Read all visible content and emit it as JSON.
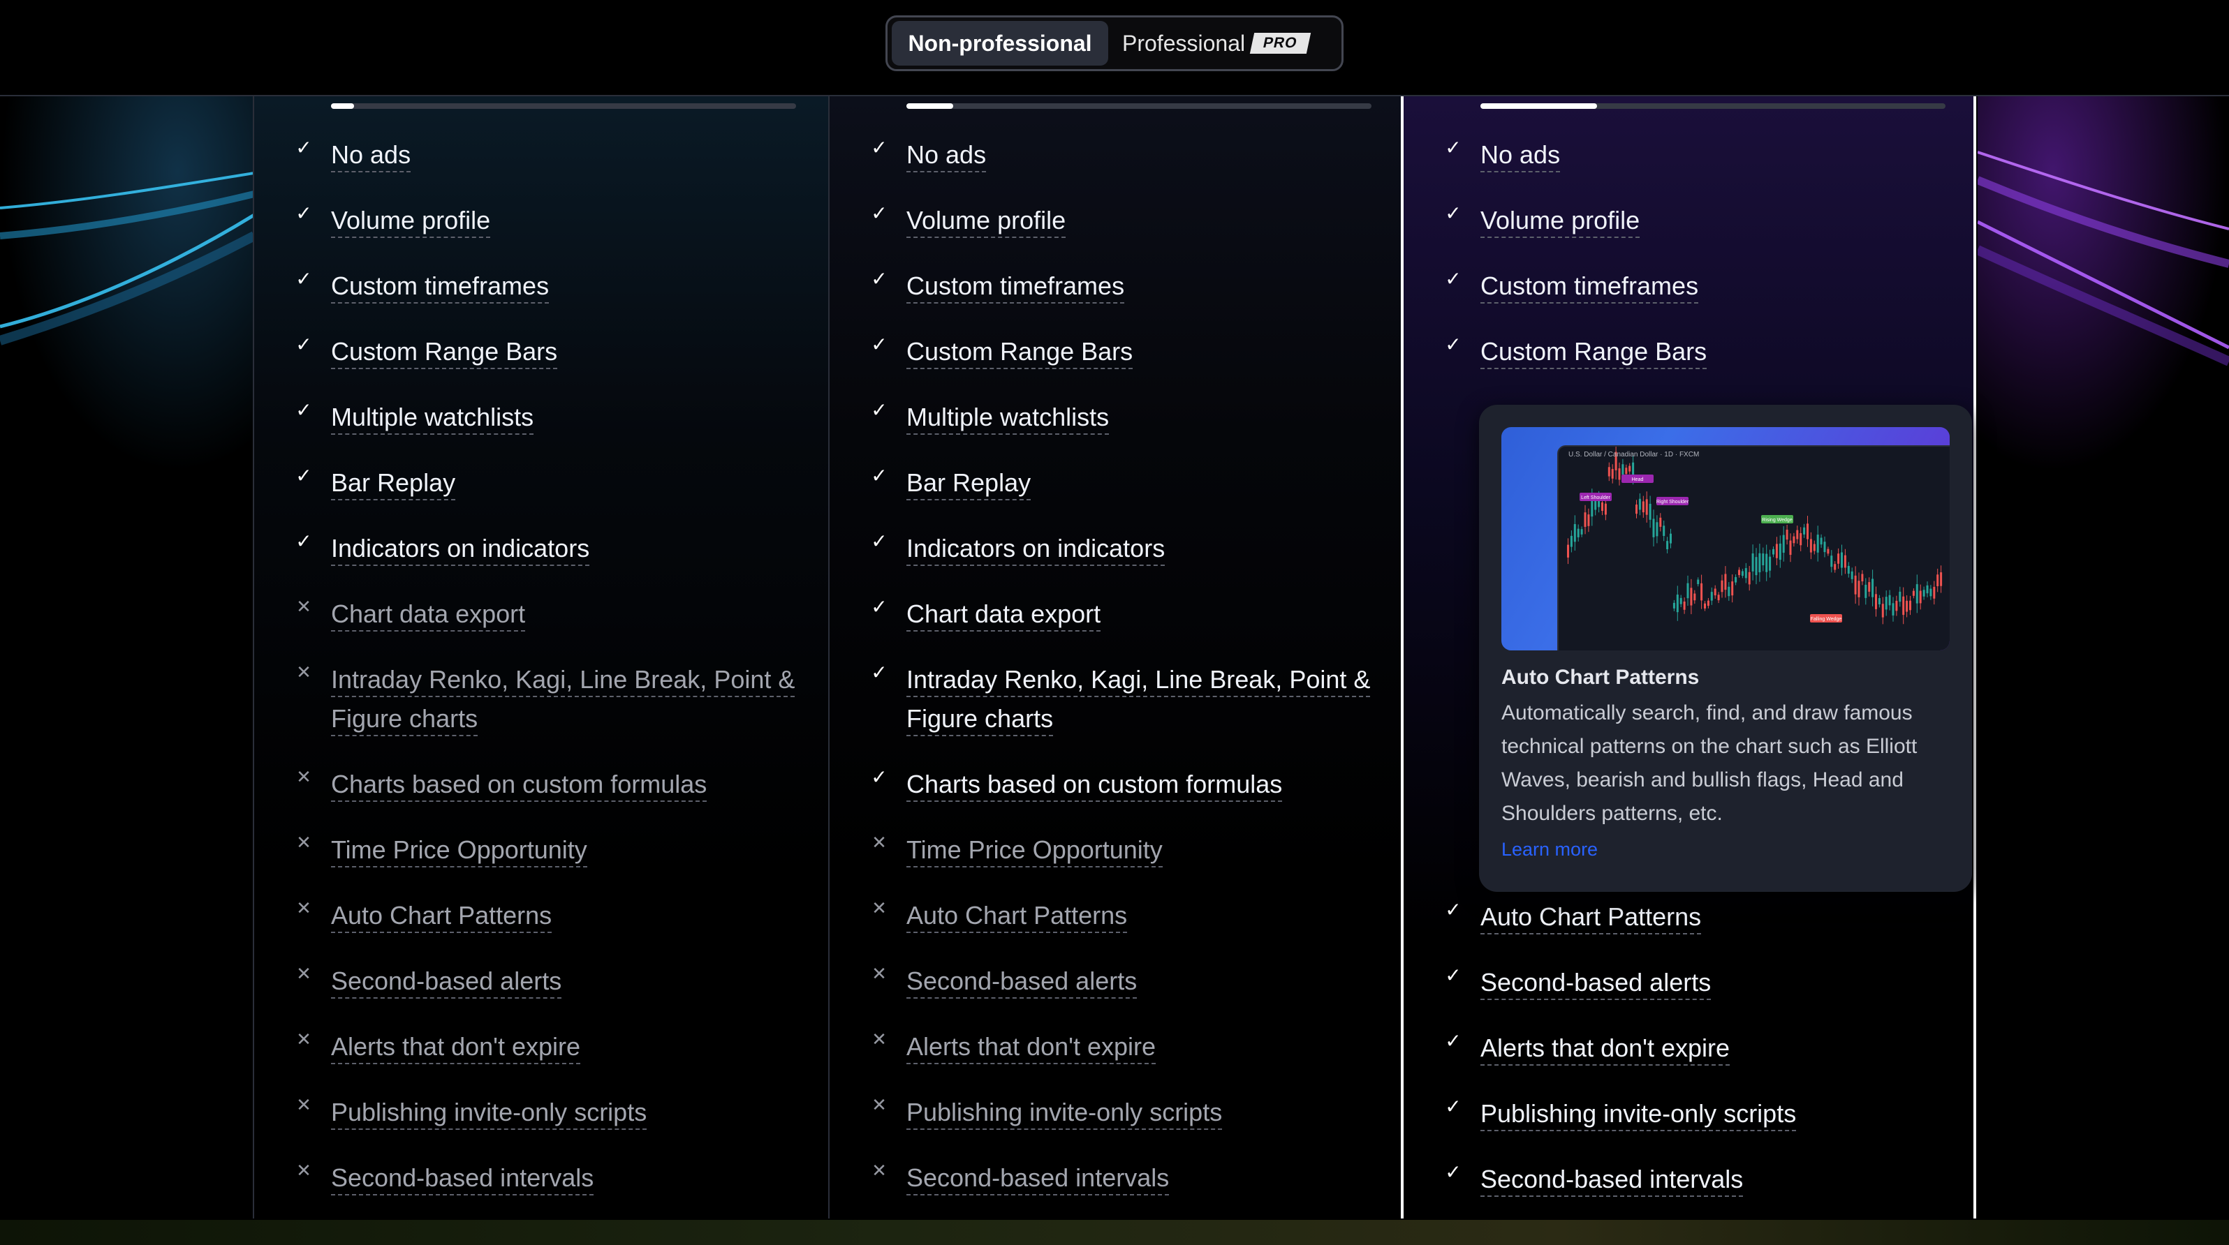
{
  "toggle": {
    "non_professional": "Non-professional",
    "professional": "Professional",
    "pro_badge": "PRO"
  },
  "columns": [
    {
      "progress": 0.05,
      "features": [
        {
          "label": "No ads",
          "included": true
        },
        {
          "label": "Volume profile",
          "included": true
        },
        {
          "label": "Custom timeframes",
          "included": true
        },
        {
          "label": "Custom Range Bars",
          "included": true
        },
        {
          "label": "Multiple watchlists",
          "included": true
        },
        {
          "label": "Bar Replay",
          "included": true
        },
        {
          "label": "Indicators on indicators",
          "included": true
        },
        {
          "label": "Chart data export",
          "included": false
        },
        {
          "label": "Intraday Renko, Kagi, Line Break, Point & Figure charts",
          "included": false
        },
        {
          "label": "Charts based on custom formulas",
          "included": false
        },
        {
          "label": "Time Price Opportunity",
          "included": false
        },
        {
          "label": "Auto Chart Patterns",
          "included": false
        },
        {
          "label": "Second-based alerts",
          "included": false
        },
        {
          "label": "Alerts that don't expire",
          "included": false
        },
        {
          "label": "Publishing invite-only scripts",
          "included": false
        },
        {
          "label": "Second-based intervals",
          "included": false
        }
      ]
    },
    {
      "progress": 0.1,
      "features": [
        {
          "label": "No ads",
          "included": true
        },
        {
          "label": "Volume profile",
          "included": true
        },
        {
          "label": "Custom timeframes",
          "included": true
        },
        {
          "label": "Custom Range Bars",
          "included": true
        },
        {
          "label": "Multiple watchlists",
          "included": true
        },
        {
          "label": "Bar Replay",
          "included": true
        },
        {
          "label": "Indicators on indicators",
          "included": true
        },
        {
          "label": "Chart data export",
          "included": true
        },
        {
          "label": "Intraday Renko, Kagi, Line Break, Point & Figure charts",
          "included": true
        },
        {
          "label": "Charts based on custom formulas",
          "included": true
        },
        {
          "label": "Time Price Opportunity",
          "included": false
        },
        {
          "label": "Auto Chart Patterns",
          "included": false
        },
        {
          "label": "Second-based alerts",
          "included": false
        },
        {
          "label": "Alerts that don't expire",
          "included": false
        },
        {
          "label": "Publishing invite-only scripts",
          "included": false
        },
        {
          "label": "Second-based intervals",
          "included": false
        }
      ]
    },
    {
      "progress": 0.25,
      "features": [
        {
          "label": "No ads",
          "included": true
        },
        {
          "label": "Volume profile",
          "included": true
        },
        {
          "label": "Custom timeframes",
          "included": true
        },
        {
          "label": "Custom Range Bars",
          "included": true
        },
        {
          "label": "Auto Chart Patterns",
          "included": true
        },
        {
          "label": "Second-based alerts",
          "included": true
        },
        {
          "label": "Alerts that don't expire",
          "included": true
        },
        {
          "label": "Publishing invite-only scripts",
          "included": true
        },
        {
          "label": "Second-based intervals",
          "included": true
        }
      ]
    }
  ],
  "tooltip": {
    "title": "Auto Chart Patterns",
    "description": "Automatically search, find, and draw famous technical patterns on the chart such as Elliott Waves, bearish and bullish flags, Head and Shoulders patterns, etc.",
    "link": "Learn more",
    "preview_title": "U.S. Dollar / Canadian Dollar · 1D · FXCM",
    "preview_labels": [
      "Head",
      "Left Shoulder",
      "Right Shoulder",
      "Rising Wedge",
      "Falling Wedge"
    ]
  },
  "colors": {
    "included": "#ffffff",
    "excluded": "#9598a1",
    "link": "#2962ff",
    "active_border": "#ffffff"
  }
}
